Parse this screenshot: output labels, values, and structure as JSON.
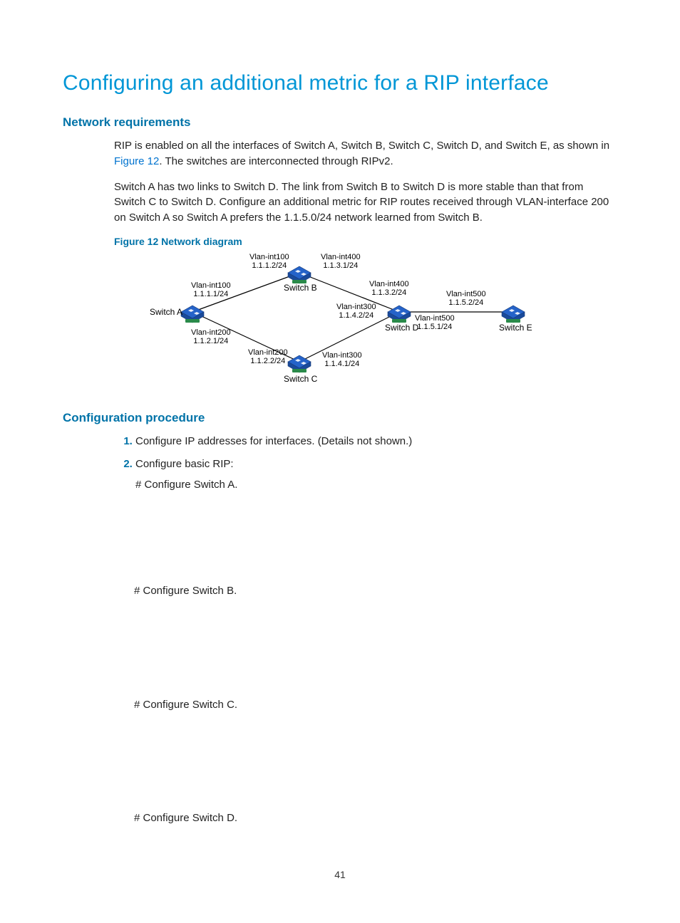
{
  "title": "Configuring an additional metric for a RIP interface",
  "sections": {
    "req_heading": "Network requirements",
    "req_p1_a": "RIP is enabled on all the interfaces of Switch A, Switch B, Switch C, Switch D, and Switch E, as shown in ",
    "req_p1_link": "Figure 12",
    "req_p1_b": ". The switches are interconnected through RIPv2.",
    "req_p2": "Switch A has two links to Switch D. The link from Switch B to Switch D is more stable than that from Switch C to Switch D. Configure an additional metric for RIP routes received through VLAN-interface 200 on Switch A so Switch A prefers the 1.1.5.0/24 network learned from Switch B.",
    "fig_caption": "Figure 12 Network diagram",
    "proc_heading": "Configuration procedure",
    "step1": "Configure IP addresses for interfaces. (Details not shown.)",
    "step2": "Configure basic RIP:",
    "cfg_a": "# Configure Switch A.",
    "cfg_b": "# Configure Switch B.",
    "cfg_c": "# Configure Switch C.",
    "cfg_d": "# Configure Switch D."
  },
  "diagram": {
    "switches": {
      "a": "Switch A",
      "b": "Switch B",
      "c": "Switch C",
      "d": "Switch D",
      "e": "Switch E"
    },
    "labels": {
      "a_top": {
        "l1": "Vlan-int100",
        "l2": "1.1.1.1/24"
      },
      "a_bot": {
        "l1": "Vlan-int200",
        "l2": "1.1.2.1/24"
      },
      "b_left": {
        "l1": "Vlan-int100",
        "l2": "1.1.1.2/24"
      },
      "b_right": {
        "l1": "Vlan-int400",
        "l2": "1.1.3.1/24"
      },
      "c_left": {
        "l1": "Vlan-int200",
        "l2": "1.1.2.2/24"
      },
      "c_right": {
        "l1": "Vlan-int300",
        "l2": "1.1.4.1/24"
      },
      "d_topleft": {
        "l1": "Vlan-int400",
        "l2": "1.1.3.2/24"
      },
      "d_botleft": {
        "l1": "Vlan-int300",
        "l2": "1.1.4.2/24"
      },
      "d_right": {
        "l1": "Vlan-int500",
        "l2": "1.1.5.1/24"
      },
      "e_left": {
        "l1": "Vlan-int500",
        "l2": "1.1.5.2/24"
      }
    }
  },
  "page_number": "41"
}
